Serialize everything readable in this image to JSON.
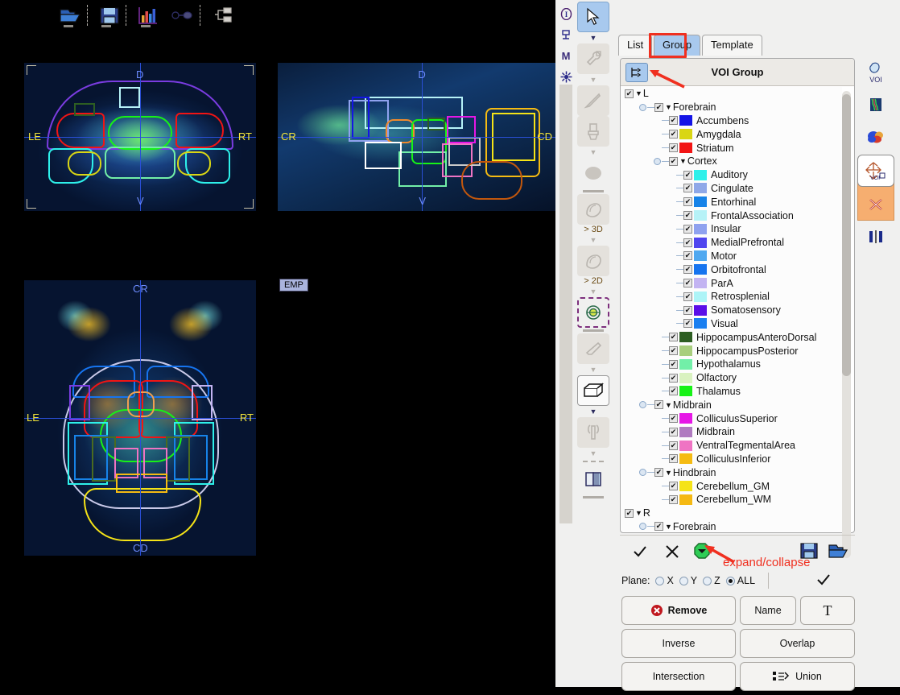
{
  "app": {
    "title": "VOI Group",
    "left_icon_column": [
      {
        "name": "info-icon",
        "glyph": "Ⓘ"
      },
      {
        "name": "clamp-icon",
        "glyph": "╤"
      },
      {
        "name": "m-icon",
        "glyph": "M"
      },
      {
        "name": "crosshair-star-icon",
        "glyph": "✤"
      }
    ]
  },
  "toolbar": {
    "items": [
      {
        "name": "open-folder-icon",
        "label": "Open"
      },
      {
        "name": "save-disk-icon",
        "label": "Save"
      },
      {
        "name": "chart-bar-icon",
        "label": "Statistics"
      },
      {
        "name": "pin-icon",
        "label": "Pin"
      },
      {
        "name": "branch-icon",
        "label": "Branch"
      }
    ]
  },
  "tools": {
    "items": [
      {
        "name": "pointer-tool",
        "state": "selected",
        "glyph": "➤"
      },
      {
        "name": "wrench-tool",
        "state": "disabled"
      },
      {
        "name": "scalpel-tool",
        "state": "disabled"
      },
      {
        "name": "brush-tool",
        "state": "disabled"
      },
      {
        "name": "blob-tool",
        "state": "disabled"
      },
      {
        "name": "region-3d-tool",
        "state": "disabled",
        "label": "> 3D"
      },
      {
        "name": "region-2d-tool",
        "state": "disabled",
        "label": "> 2D"
      },
      {
        "name": "target-tool",
        "state": "dashed"
      },
      {
        "name": "eraser-tool",
        "state": "disabled"
      },
      {
        "name": "cube-tool",
        "state": "white"
      },
      {
        "name": "mirror-tool",
        "state": "disabled"
      },
      {
        "name": "split-view-tool",
        "state": "plain"
      }
    ],
    "labels": {
      "region3d": "> 3D",
      "region2d": "> 2D"
    }
  },
  "tabs": [
    {
      "label": "List",
      "active": false
    },
    {
      "label": "Group",
      "active": true
    },
    {
      "label": "Template",
      "active": false
    }
  ],
  "tree": [
    {
      "label": "L",
      "depth": 0,
      "type": "root",
      "checked": true,
      "expanded": true
    },
    {
      "label": "Forebrain",
      "depth": 1,
      "type": "branch",
      "checked": true,
      "expanded": true
    },
    {
      "label": "Accumbens",
      "depth": 2,
      "type": "leaf",
      "checked": true,
      "color": "#1414e6"
    },
    {
      "label": "Amygdala",
      "depth": 2,
      "type": "leaf",
      "checked": true,
      "color": "#d9d614"
    },
    {
      "label": "Striatum",
      "depth": 2,
      "type": "leaf",
      "checked": true,
      "color": "#f21414"
    },
    {
      "label": "Cortex",
      "depth": 2,
      "type": "branch",
      "checked": true,
      "expanded": true
    },
    {
      "label": "Auditory",
      "depth": 3,
      "type": "leaf",
      "checked": true,
      "color": "#2ef0ea"
    },
    {
      "label": "Cingulate",
      "depth": 3,
      "type": "leaf",
      "checked": true,
      "color": "#8fa8e8"
    },
    {
      "label": "Entorhinal",
      "depth": 3,
      "type": "leaf",
      "checked": true,
      "color": "#1783e8"
    },
    {
      "label": "FrontalAssociation",
      "depth": 3,
      "type": "leaf",
      "checked": true,
      "color": "#b6f2f7"
    },
    {
      "label": "Insular",
      "depth": 3,
      "type": "leaf",
      "checked": true,
      "color": "#8fa2ef"
    },
    {
      "label": "MedialPrefrontal",
      "depth": 3,
      "type": "leaf",
      "checked": true,
      "color": "#5046ef"
    },
    {
      "label": "Motor",
      "depth": 3,
      "type": "leaf",
      "checked": true,
      "color": "#4fa8f0"
    },
    {
      "label": "Orbitofrontal",
      "depth": 3,
      "type": "leaf",
      "checked": true,
      "color": "#1674ef"
    },
    {
      "label": "ParA",
      "depth": 3,
      "type": "leaf",
      "checked": true,
      "color": "#c3b4f2"
    },
    {
      "label": "Retrosplenial",
      "depth": 3,
      "type": "leaf",
      "checked": true,
      "color": "#adf4f7"
    },
    {
      "label": "Somatosensory",
      "depth": 3,
      "type": "leaf",
      "checked": true,
      "color": "#5a0ee8"
    },
    {
      "label": "Visual",
      "depth": 3,
      "type": "leaf",
      "checked": true,
      "color": "#1a7ff0"
    },
    {
      "label": "HippocampusAnteroDorsal",
      "depth": 2,
      "type": "leaf",
      "checked": true,
      "color": "#2d5e22"
    },
    {
      "label": "HippocampusPosterior",
      "depth": 2,
      "type": "leaf",
      "checked": true,
      "color": "#a8ce7d"
    },
    {
      "label": "Hypothalamus",
      "depth": 2,
      "type": "leaf",
      "checked": true,
      "color": "#72efa8"
    },
    {
      "label": "Olfactory",
      "depth": 2,
      "type": "leaf",
      "checked": true,
      "color": "#d9f2c0"
    },
    {
      "label": "Thalamus",
      "depth": 2,
      "type": "leaf",
      "checked": true,
      "color": "#17f217"
    },
    {
      "label": "Midbrain",
      "depth": 1,
      "type": "branch",
      "checked": true,
      "expanded": true
    },
    {
      "label": "ColliculusSuperior",
      "depth": 2,
      "type": "leaf",
      "checked": true,
      "color": "#e617e6"
    },
    {
      "label": "Midbrain",
      "depth": 2,
      "type": "leaf",
      "checked": true,
      "color": "#b07bc0"
    },
    {
      "label": "VentralTegmentalArea",
      "depth": 2,
      "type": "leaf",
      "checked": true,
      "color": "#ef74c3"
    },
    {
      "label": "ColliculusInferior",
      "depth": 2,
      "type": "leaf",
      "checked": true,
      "color": "#f5bb13"
    },
    {
      "label": "Hindbrain",
      "depth": 1,
      "type": "branch",
      "checked": true,
      "expanded": true
    },
    {
      "label": "Cerebellum_GM",
      "depth": 2,
      "type": "leaf",
      "checked": true,
      "color": "#f5e317"
    },
    {
      "label": "Cerebellum_WM",
      "depth": 2,
      "type": "leaf",
      "checked": true,
      "color": "#f5b913"
    },
    {
      "label": "R",
      "depth": 0,
      "type": "root",
      "checked": true,
      "expanded": true
    },
    {
      "label": "Forebrain",
      "depth": 1,
      "type": "branch",
      "checked": true,
      "expanded": true
    }
  ],
  "right_rail": [
    {
      "name": "voi-icon",
      "label": "VOI"
    },
    {
      "name": "colormap-icon",
      "label": ""
    },
    {
      "name": "palette-sphere-icon",
      "label": ""
    },
    {
      "name": "move-voi-icon",
      "label": "VOI"
    },
    {
      "name": "delete-voi-icon",
      "label": ""
    },
    {
      "name": "mirror-voi-icon",
      "label": ""
    }
  ],
  "bottom": {
    "confirm_icon": "check-icon",
    "cancel_icon": "x-icon",
    "expand_collapse_icon": "expand-collapse-icon",
    "save_icon": "save-disk-icon",
    "open_icon": "open-folder-icon",
    "annotation": "expand/collapse",
    "plane_label": "Plane:",
    "plane_options": [
      {
        "label": "X",
        "selected": false
      },
      {
        "label": "Y",
        "selected": false
      },
      {
        "label": "Z",
        "selected": false
      },
      {
        "label": "ALL",
        "selected": true
      }
    ],
    "apply_icon": "check-icon",
    "buttons": [
      {
        "label": "Remove",
        "icon": "remove-circle-icon",
        "bold": true
      },
      {
        "label": "Name",
        "icon": ""
      },
      {
        "label": "T",
        "icon": "text-tool-icon"
      },
      {
        "label": "Inverse",
        "icon": ""
      },
      {
        "label": "Overlap",
        "icon": ""
      },
      {
        "label": "Intersection",
        "icon": ""
      },
      {
        "label": "Union",
        "icon": "union-icon"
      }
    ]
  },
  "viewer": {
    "emp_label": "EMP",
    "coronal": {
      "top": "D",
      "bottom": "V",
      "left": "LE",
      "right": "RT"
    },
    "sagittal": {
      "top": "D",
      "bottom": "V",
      "left": "CR",
      "right": "CD"
    },
    "axial": {
      "top": "CR",
      "bottom": "CD",
      "left": "LE",
      "right": "RT"
    }
  },
  "colors": {
    "accent": "#a8c9ee",
    "annotation": "#f03020",
    "highlight_orange": "#f6ae70",
    "panel_bg": "#f0f0ef"
  }
}
